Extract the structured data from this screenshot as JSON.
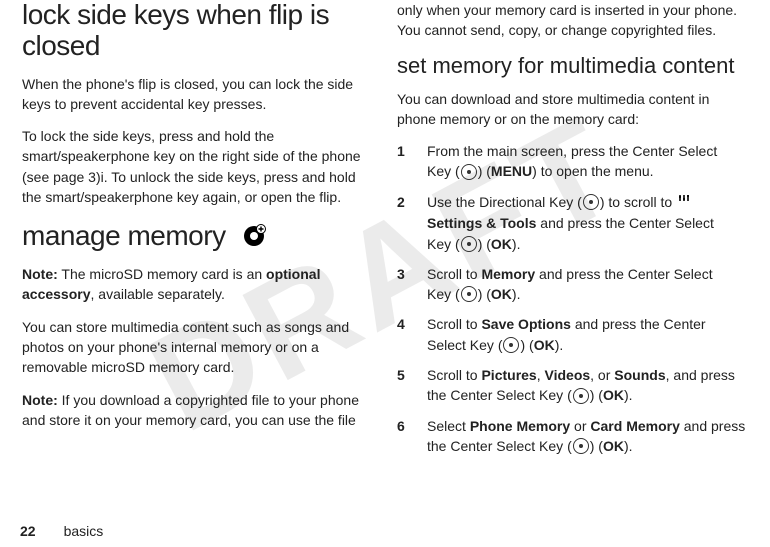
{
  "watermark": "DRAFT",
  "left": {
    "heading1": "lock side keys when flip is closed",
    "p1": "When the phone's flip is closed, you can lock the side keys to prevent accidental key presses.",
    "p2": "To lock the side keys, press and hold the smart/speakerphone key on the right side of the phone (see page 3)i. To unlock the side keys, press and hold the smart/speakerphone key again, or open the flip.",
    "heading2": "manage memory",
    "note1_label": "Note:",
    "note1_a": " The microSD memory card is an ",
    "note1_bold": "optional accessory",
    "note1_b": ", available separately.",
    "p3": "You can store multimedia content such as songs and photos on your phone's internal memory or on a removable microSD memory card.",
    "note2_label": "Note:",
    "note2": " If you download a copyrighted file to your phone and store it on your memory card, you can use the file"
  },
  "right": {
    "cont": "only when your memory card is inserted in your phone. You cannot send, copy, or change copyrighted files.",
    "sub": "set memory for multimedia content",
    "intro": "You can download and store multimedia content in phone memory or on the memory card:",
    "step1_a": "From the main screen, press the Center Select Key (",
    "step1_b": ") (",
    "step1_menu": "MENU",
    "step1_c": ") to open the menu.",
    "step2_a": "Use the Directional Key (",
    "step2_b": ") to scroll to ",
    "step2_st": " Settings & Tools",
    "step2_c": " and press the Center Select Key (",
    "step2_d": ") (",
    "step2_ok": "OK",
    "step2_e": ").",
    "step3_a": "Scroll to ",
    "step3_mem": "Memory",
    "step3_b": " and press the Center Select Key (",
    "step3_c": ") (",
    "step3_ok": "OK",
    "step3_d": ").",
    "step4_a": "Scroll to ",
    "step4_save": "Save Options",
    "step4_b": " and press the Center Select Key (",
    "step4_c": ") (",
    "step4_ok": "OK",
    "step4_d": ").",
    "step5_a": "Scroll to ",
    "step5_pic": "Pictures",
    "step5_sep1": ", ",
    "step5_vid": "Videos",
    "step5_sep2": ", or ",
    "step5_snd": "Sounds",
    "step5_b": ", and press the Center Select Key (",
    "step5_c": ") (",
    "step5_ok": "OK",
    "step5_d": ").",
    "step6_a": "Select ",
    "step6_pm": "Phone Memory",
    "step6_or": " or ",
    "step6_cm": "Card Memory",
    "step6_b": " and press the Center Select Key (",
    "step6_c": ") (",
    "step6_ok": "OK",
    "step6_d": ")."
  },
  "footer": {
    "page": "22",
    "section": "basics"
  }
}
